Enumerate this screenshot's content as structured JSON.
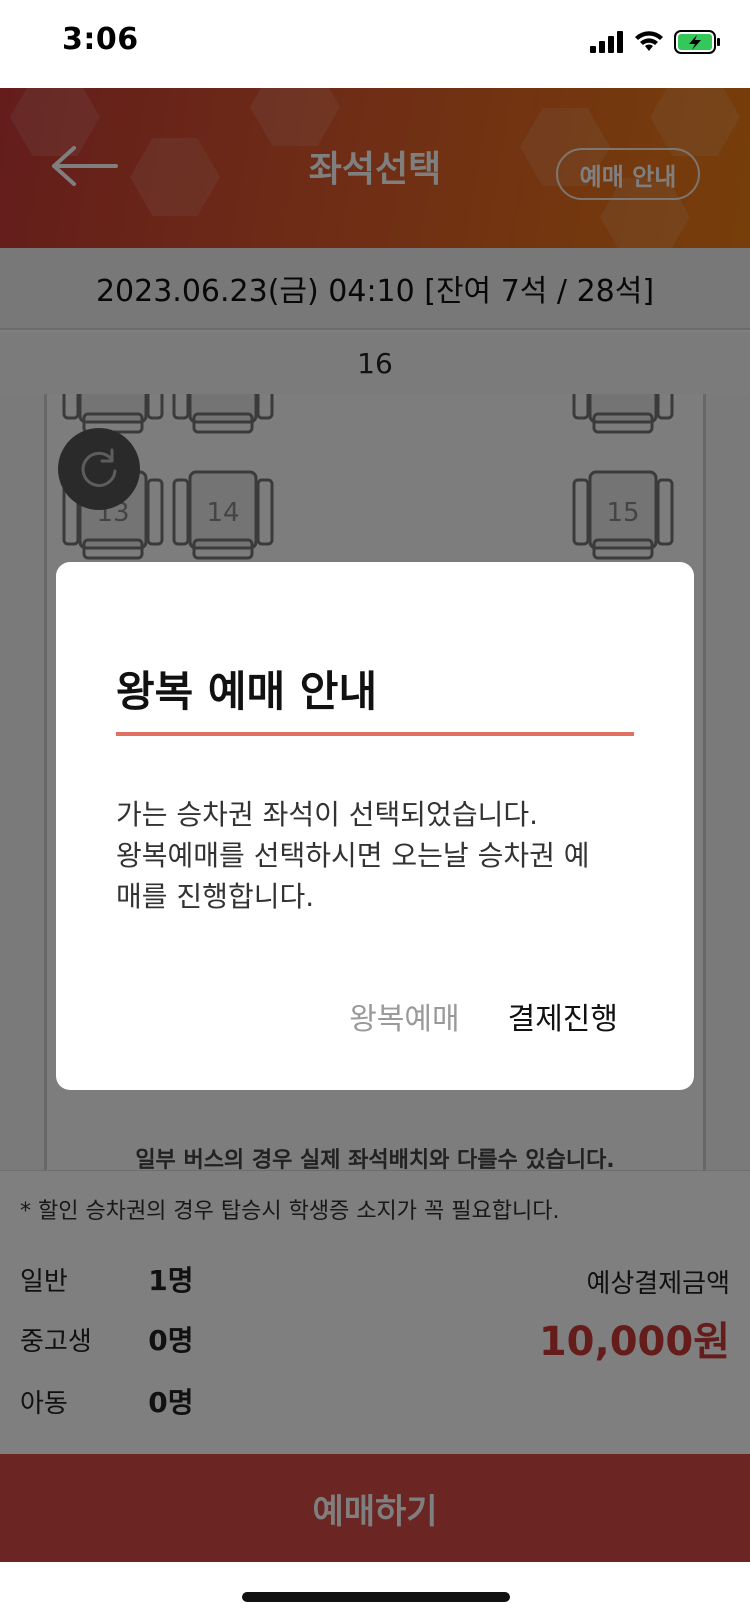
{
  "status_bar": {
    "time": "3:06"
  },
  "header": {
    "title": "좌석선택",
    "guide_button": "예매 안내"
  },
  "trip_info": {
    "date_line": "2023.06.23(금) 04:10 [잔여 7석 / 28석]",
    "bus_number": "16"
  },
  "seats": [
    "13",
    "14",
    "15"
  ],
  "seat_notice": "일부 버스의 경우 실제 좌석배치와 다를수 있습니다.",
  "summary": {
    "discount_note": "* 할인 승차권의 경우 탑승시 학생증 소지가 꼭 필요합니다.",
    "passengers": [
      {
        "label": "일반",
        "count": "1명"
      },
      {
        "label": "중고생",
        "count": "0명"
      },
      {
        "label": "아동",
        "count": "0명"
      }
    ],
    "price_label": "예상결제금액",
    "price_value": "10,000원"
  },
  "reserve_button": "예매하기",
  "dialog": {
    "title": "왕복 예매 안내",
    "body_lines": [
      "가는 승차권 좌석이 선택되었습니다.",
      "왕복예매를 선택하시면 오는날 승차권 예",
      "매를 진행합니다."
    ],
    "roundtrip_button": "왕복예매",
    "pay_button": "결제진행"
  },
  "colors": {
    "brand_red": "#c83a37",
    "brand_orange": "#ee7d14",
    "reserve_button": "#d64a44",
    "dialog_divider": "#e07060"
  }
}
